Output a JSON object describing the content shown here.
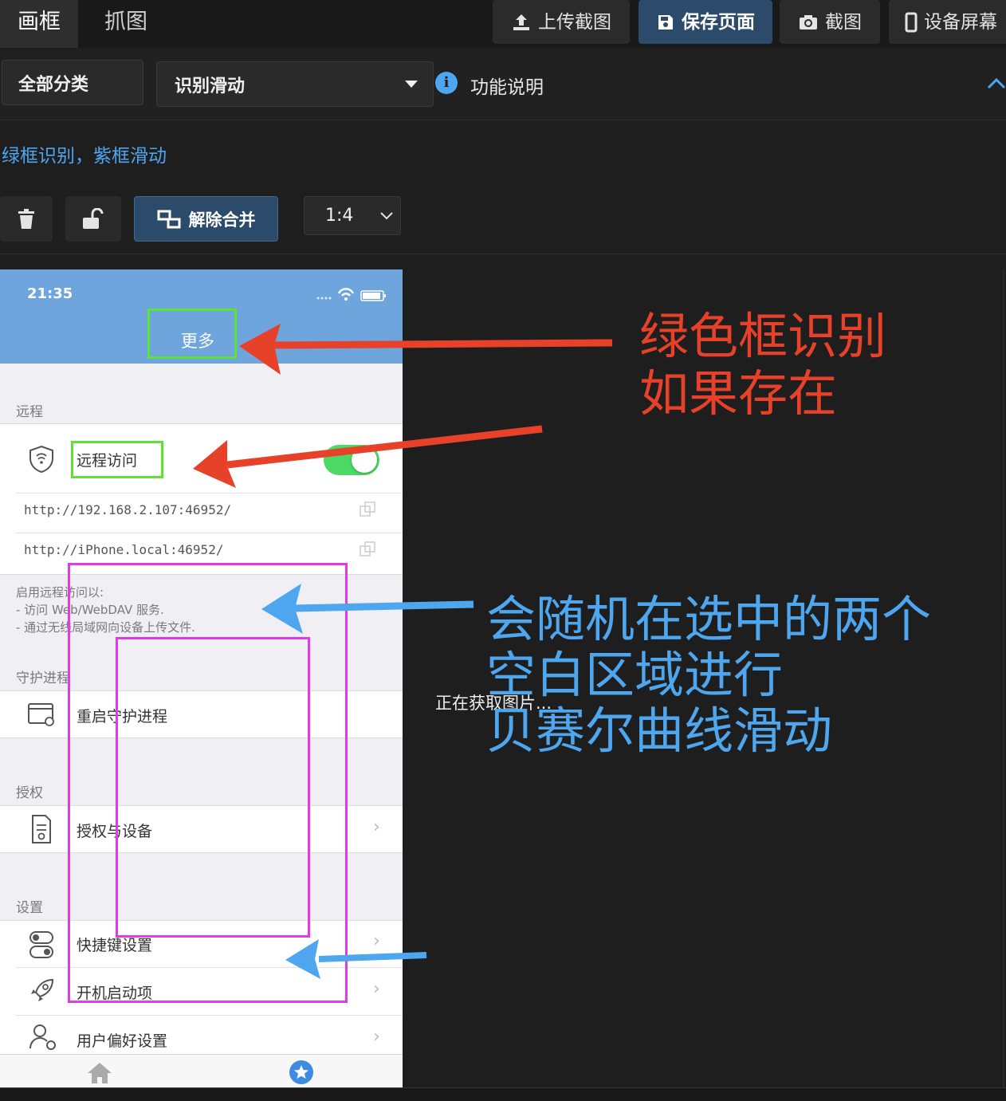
{
  "tabs": [
    {
      "label": "画框",
      "active": true
    },
    {
      "label": "抓图",
      "active": false
    }
  ],
  "toolbar": {
    "upload_label": "上传截图",
    "save_label": "保存页面",
    "screenshot_label": "截图",
    "device_label": "设备屏幕"
  },
  "filter": {
    "category_label": "全部分类",
    "action_selected": "识别滑动",
    "help_label": "功能说明"
  },
  "description": "绿框识别，紫框滑动",
  "tools": {
    "unmerge_label": "解除合并",
    "ratio_selected": "1:4"
  },
  "loading_text": "正在获取图片...",
  "phone": {
    "time": "21:35",
    "header_title": "更多",
    "sections": {
      "remote": "远程",
      "daemon": "守护进程",
      "license": "授权",
      "settings": "设置"
    },
    "remote_access": "远程访问",
    "url1": "http://192.168.2.107:46952/",
    "url2": "http://iPhone.local:46952/",
    "remote_note": [
      "启用远程访问以:",
      "- 访问 Web/WebDAV 服务.",
      "- 通过无线局域网向设备上传文件."
    ],
    "restart_daemon": "重启守护进程",
    "license_devices": "授权与设备",
    "shortcut_settings": "快捷键设置",
    "startup_items": "开机启动项",
    "user_prefs": "用户偏好设置"
  },
  "annotations": {
    "red": [
      "绿色框识别",
      "如果存在"
    ],
    "blue": [
      "会随机在选中的两个",
      "空白区域进行",
      "贝赛尔曲线滑动"
    ]
  },
  "colors": {
    "accent_blue": "#4ea6ef",
    "annotation_red": "#e8412a",
    "green_frame": "#5ee234",
    "purple_frame": "#e23ae8",
    "phone_header": "#6fa5dd"
  }
}
